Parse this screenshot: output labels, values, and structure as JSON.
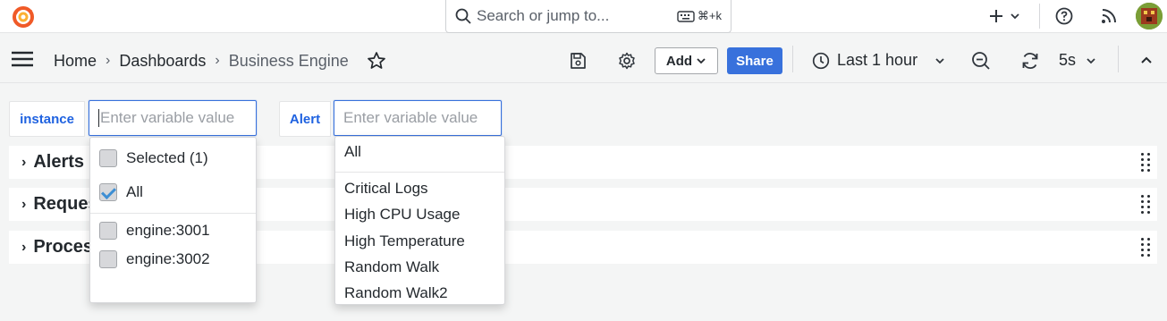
{
  "topbar": {
    "search_placeholder": "Search or jump to...",
    "search_shortcut": "⌘+k",
    "icons": [
      "grafana-logo-icon",
      "search-icon",
      "keyboard-icon",
      "plus-icon",
      "chevron-down-icon",
      "help-icon",
      "rss-icon",
      "avatar"
    ]
  },
  "breadcrumb": {
    "home": "Home",
    "dashboards": "Dashboards",
    "current": "Business Engine",
    "separator": "›"
  },
  "toolbar": {
    "add_label": "Add",
    "share_label": "Share",
    "time_range": "Last 1 hour",
    "refresh_interval": "5s"
  },
  "variables": {
    "instance": {
      "label": "instance",
      "placeholder": "Enter variable value",
      "options": [
        {
          "label": "Selected (1)",
          "checked": false
        },
        {
          "label": "All",
          "checked": true
        },
        {
          "label": "engine:3001",
          "checked": false
        },
        {
          "label": "engine:3002",
          "checked": false
        }
      ]
    },
    "alert": {
      "label": "Alert",
      "placeholder": "Enter variable value",
      "options": [
        "All",
        "Critical Logs",
        "High CPU Usage",
        "High Temperature",
        "Random Walk",
        "Random Walk2"
      ]
    }
  },
  "rows": [
    {
      "title": "Alerts"
    },
    {
      "title": "Requests"
    },
    {
      "title": "Processes"
    }
  ],
  "colors": {
    "accent": "#3871dc",
    "variable_label": "#1f62e0",
    "background": "#f4f5f5"
  }
}
